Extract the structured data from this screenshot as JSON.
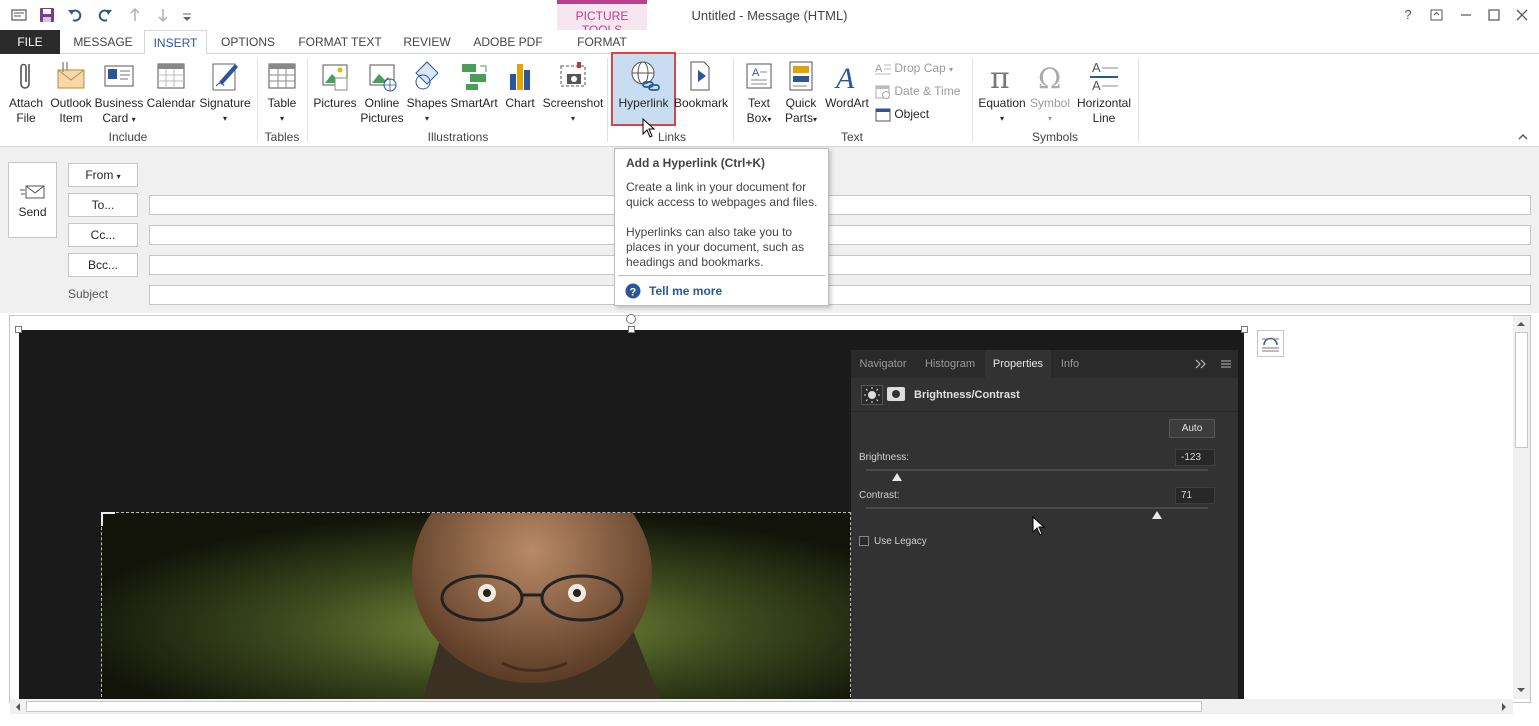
{
  "window": {
    "title": "Untitled - Message (HTML)",
    "help": "?",
    "icons": [
      "outlook-message-icon",
      "save-icon",
      "undo-icon",
      "redo-icon",
      "up-arrow-icon",
      "down-arrow-icon",
      "customize-qat-icon",
      "help-icon",
      "ribbon-display-icon",
      "minimize-icon",
      "maximize-icon",
      "close-icon"
    ]
  },
  "tabs": {
    "file": "FILE",
    "message": "MESSAGE",
    "insert": "INSERT",
    "options": "OPTIONS",
    "format_text": "FORMAT TEXT",
    "review": "REVIEW",
    "adobe_pdf": "ADOBE PDF",
    "context_group": "PICTURE TOOLS",
    "format": "FORMAT"
  },
  "ribbon": {
    "include": {
      "label": "Include",
      "attach_file": [
        "Attach",
        "File"
      ],
      "outlook_item": [
        "Outlook",
        "Item"
      ],
      "business_card": [
        "Business",
        "Card"
      ],
      "calendar": "Calendar",
      "signature": "Signature"
    },
    "tables": {
      "label": "Tables",
      "table": "Table"
    },
    "illustrations": {
      "label": "Illustrations",
      "pictures": "Pictures",
      "online_pictures": [
        "Online",
        "Pictures"
      ],
      "shapes": "Shapes",
      "smartart": "SmartArt",
      "chart": "Chart",
      "screenshot": "Screenshot"
    },
    "links": {
      "label": "Links",
      "hyperlink": "Hyperlink",
      "bookmark": "Bookmark"
    },
    "text": {
      "label": "Text",
      "text_box": [
        "Text",
        "Box"
      ],
      "quick_parts": [
        "Quick",
        "Parts"
      ],
      "wordart": "WordArt",
      "drop_cap": "Drop Cap",
      "date_time": "Date & Time",
      "object": "Object"
    },
    "symbols": {
      "label": "Symbols",
      "equation": "Equation",
      "symbol": "Symbol",
      "horizontal_line": [
        "Horizontal",
        "Line"
      ]
    },
    "accent_color": "#2b579a",
    "context_color": "#b8428c"
  },
  "tooltip": {
    "title": "Add a Hyperlink (Ctrl+K)",
    "para1": [
      "Create a link in your document for",
      "quick access to webpages and files."
    ],
    "para2": [
      "Hyperlinks can also take you to",
      "places in your document, such as",
      "headings and bookmarks."
    ],
    "more": "Tell me more"
  },
  "header": {
    "send": "Send",
    "from": "From",
    "to": "To...",
    "cc": "Cc...",
    "bcc": "Bcc...",
    "subject": "Subject",
    "to_value": "",
    "cc_value": "",
    "bcc_value": "",
    "subject_value": ""
  },
  "ps_panel": {
    "tabs": [
      "Navigator",
      "Histogram",
      "Properties",
      "Info"
    ],
    "active_tab": "Properties",
    "adjustment": "Brightness/Contrast",
    "auto": "Auto",
    "brightness_label": "Brightness:",
    "brightness_value": "-123",
    "brightness_fraction": 0.09,
    "contrast_label": "Contrast:",
    "contrast_value": "71",
    "contrast_fraction": 0.85,
    "use_legacy": "Use Legacy",
    "use_legacy_checked": false
  }
}
